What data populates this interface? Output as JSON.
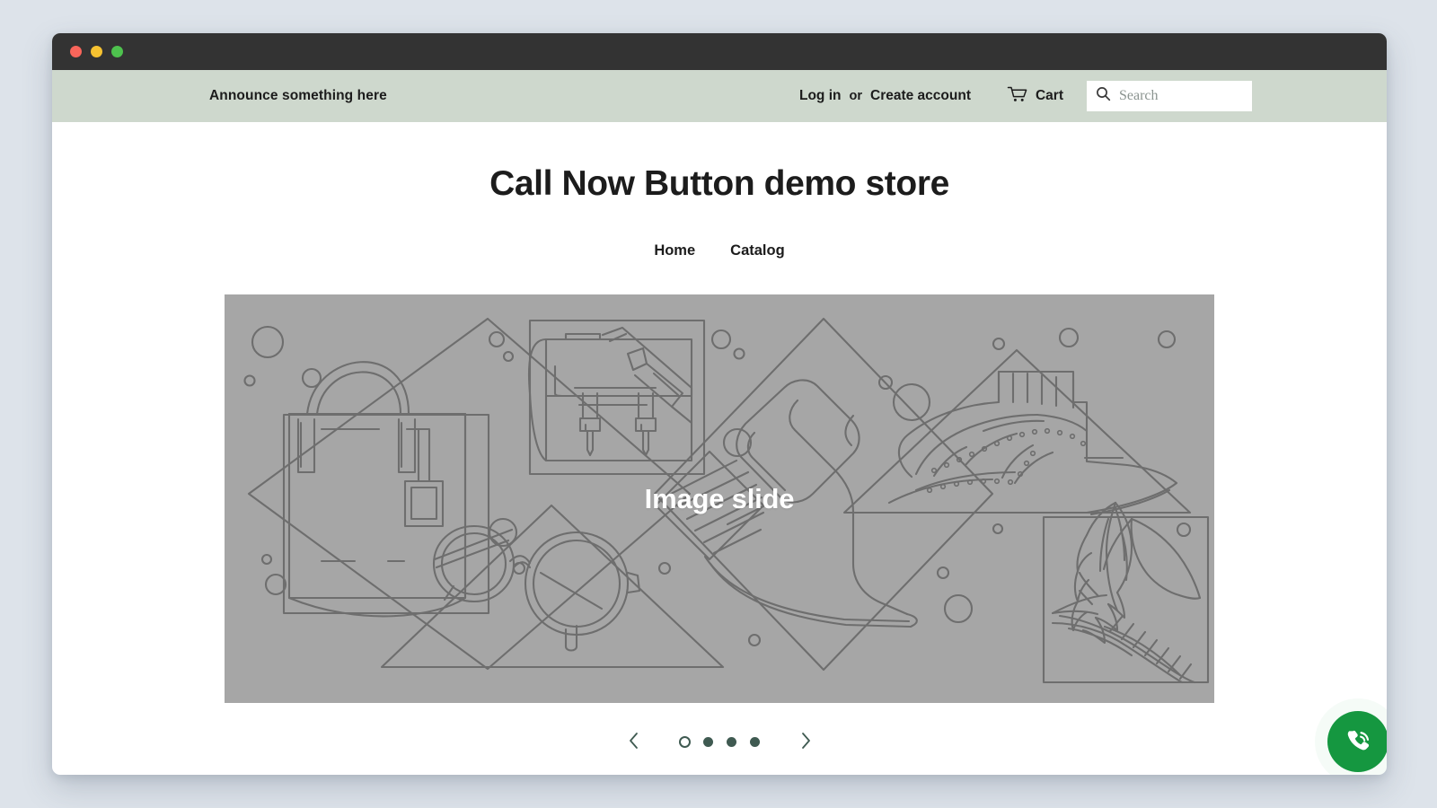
{
  "window": {
    "traffic_lights": [
      "close",
      "minimize",
      "zoom"
    ]
  },
  "announcement": {
    "text": "Announce something here"
  },
  "header": {
    "login_label": "Log in",
    "or_label": "or",
    "create_account_label": "Create account",
    "cart_label": "Cart",
    "cart_icon": "shopping-cart-icon",
    "search_icon": "search-icon",
    "search_placeholder": "Search",
    "search_value": ""
  },
  "store": {
    "title": "Call Now Button demo store",
    "nav": [
      {
        "label": "Home"
      },
      {
        "label": "Catalog"
      }
    ]
  },
  "hero": {
    "caption": "Image slide",
    "background_color": "#a6a6a6",
    "line_color": "#6e6e6e",
    "illustration_items": [
      "handbag-in-diamond",
      "satchel-in-square",
      "eyeglasses-in-triangle",
      "high-heel-in-diamond",
      "brogue-shoe-in-triangle",
      "feather-quill-in-square"
    ]
  },
  "carousel": {
    "prev_icon": "chevron-left-icon",
    "next_icon": "chevron-right-icon",
    "slide_count": 4,
    "active_slide": 1,
    "dot_color": "#3f5a51"
  },
  "call_button": {
    "icon": "phone-call-icon",
    "color": "#159740"
  },
  "colors": {
    "page_background": "#dde3ea",
    "titlebar": "#333333",
    "announcement_bar": "#ced8cd",
    "accent": "#3f5a51",
    "call_green": "#159740"
  }
}
